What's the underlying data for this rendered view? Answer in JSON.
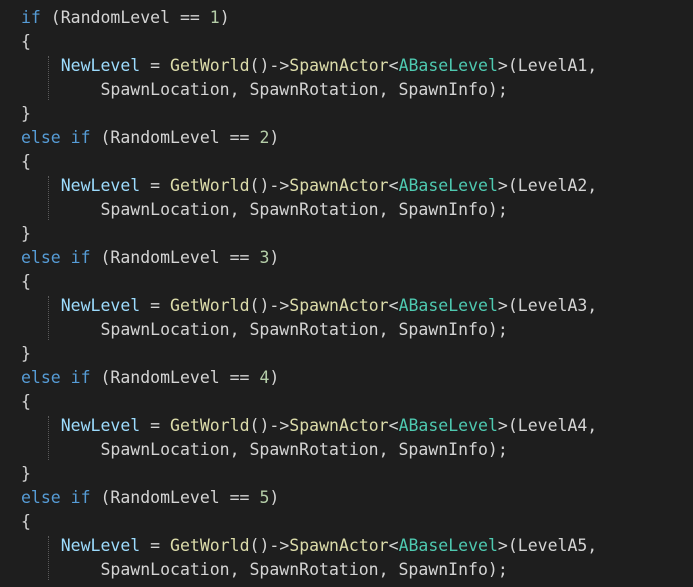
{
  "code": {
    "lines": [
      [
        {
          "t": "if",
          "c": "kw"
        },
        {
          "t": " (RandomLevel == ",
          "c": "op"
        },
        {
          "t": "1",
          "c": "num"
        },
        {
          "t": ")",
          "c": "op"
        }
      ],
      [
        {
          "t": "{",
          "c": "op"
        }
      ],
      [
        {
          "t": "    ",
          "c": "op"
        },
        {
          "t": "NewLevel",
          "c": "var"
        },
        {
          "t": " = ",
          "c": "op"
        },
        {
          "t": "GetWorld",
          "c": "fn"
        },
        {
          "t": "()->",
          "c": "op"
        },
        {
          "t": "SpawnActor",
          "c": "fn"
        },
        {
          "t": "<",
          "c": "op"
        },
        {
          "t": "ABaseLevel",
          "c": "type"
        },
        {
          "t": ">(LevelA1,",
          "c": "op"
        }
      ],
      [
        {
          "t": "        SpawnLocation, SpawnRotation, SpawnInfo);",
          "c": "op"
        }
      ],
      [
        {
          "t": "}",
          "c": "op"
        }
      ],
      [
        {
          "t": "else if",
          "c": "kw"
        },
        {
          "t": " (RandomLevel == ",
          "c": "op"
        },
        {
          "t": "2",
          "c": "num"
        },
        {
          "t": ")",
          "c": "op"
        }
      ],
      [
        {
          "t": "{",
          "c": "op"
        }
      ],
      [
        {
          "t": "    ",
          "c": "op"
        },
        {
          "t": "NewLevel",
          "c": "var"
        },
        {
          "t": " = ",
          "c": "op"
        },
        {
          "t": "GetWorld",
          "c": "fn"
        },
        {
          "t": "()->",
          "c": "op"
        },
        {
          "t": "SpawnActor",
          "c": "fn"
        },
        {
          "t": "<",
          "c": "op"
        },
        {
          "t": "ABaseLevel",
          "c": "type"
        },
        {
          "t": ">(LevelA2,",
          "c": "op"
        }
      ],
      [
        {
          "t": "        SpawnLocation, SpawnRotation, SpawnInfo);",
          "c": "op"
        }
      ],
      [
        {
          "t": "}",
          "c": "op"
        }
      ],
      [
        {
          "t": "else if",
          "c": "kw"
        },
        {
          "t": " (RandomLevel == ",
          "c": "op"
        },
        {
          "t": "3",
          "c": "num"
        },
        {
          "t": ")",
          "c": "op"
        }
      ],
      [
        {
          "t": "{",
          "c": "op"
        }
      ],
      [
        {
          "t": "    ",
          "c": "op"
        },
        {
          "t": "NewLevel",
          "c": "var"
        },
        {
          "t": " = ",
          "c": "op"
        },
        {
          "t": "GetWorld",
          "c": "fn"
        },
        {
          "t": "()->",
          "c": "op"
        },
        {
          "t": "SpawnActor",
          "c": "fn"
        },
        {
          "t": "<",
          "c": "op"
        },
        {
          "t": "ABaseLevel",
          "c": "type"
        },
        {
          "t": ">(LevelA3,",
          "c": "op"
        }
      ],
      [
        {
          "t": "        SpawnLocation, SpawnRotation, SpawnInfo);",
          "c": "op"
        }
      ],
      [
        {
          "t": "}",
          "c": "op"
        }
      ],
      [
        {
          "t": "else if",
          "c": "kw"
        },
        {
          "t": " (RandomLevel == ",
          "c": "op"
        },
        {
          "t": "4",
          "c": "num"
        },
        {
          "t": ")",
          "c": "op"
        }
      ],
      [
        {
          "t": "{",
          "c": "op"
        }
      ],
      [
        {
          "t": "    ",
          "c": "op"
        },
        {
          "t": "NewLevel",
          "c": "var"
        },
        {
          "t": " = ",
          "c": "op"
        },
        {
          "t": "GetWorld",
          "c": "fn"
        },
        {
          "t": "()->",
          "c": "op"
        },
        {
          "t": "SpawnActor",
          "c": "fn"
        },
        {
          "t": "<",
          "c": "op"
        },
        {
          "t": "ABaseLevel",
          "c": "type"
        },
        {
          "t": ">(LevelA4,",
          "c": "op"
        }
      ],
      [
        {
          "t": "        SpawnLocation, SpawnRotation, SpawnInfo);",
          "c": "op"
        }
      ],
      [
        {
          "t": "}",
          "c": "op"
        }
      ],
      [
        {
          "t": "else if",
          "c": "kw"
        },
        {
          "t": " (RandomLevel == ",
          "c": "op"
        },
        {
          "t": "5",
          "c": "num"
        },
        {
          "t": ")",
          "c": "op"
        }
      ],
      [
        {
          "t": "{",
          "c": "op"
        }
      ],
      [
        {
          "t": "    ",
          "c": "op"
        },
        {
          "t": "NewLevel",
          "c": "var"
        },
        {
          "t": " = ",
          "c": "op"
        },
        {
          "t": "GetWorld",
          "c": "fn"
        },
        {
          "t": "()->",
          "c": "op"
        },
        {
          "t": "SpawnActor",
          "c": "fn"
        },
        {
          "t": "<",
          "c": "op"
        },
        {
          "t": "ABaseLevel",
          "c": "type"
        },
        {
          "t": ">(LevelA5,",
          "c": "op"
        }
      ],
      [
        {
          "t": "        SpawnLocation, SpawnRotation, SpawnInfo);",
          "c": "op"
        }
      ]
    ]
  },
  "theme": {
    "background": "#1e1e1e",
    "keyword": "#569cd6",
    "default": "#d4d4d4",
    "number": "#b5cea8",
    "variable": "#9cdcfe",
    "function": "#dcdcaa",
    "type": "#4ec9b0"
  }
}
